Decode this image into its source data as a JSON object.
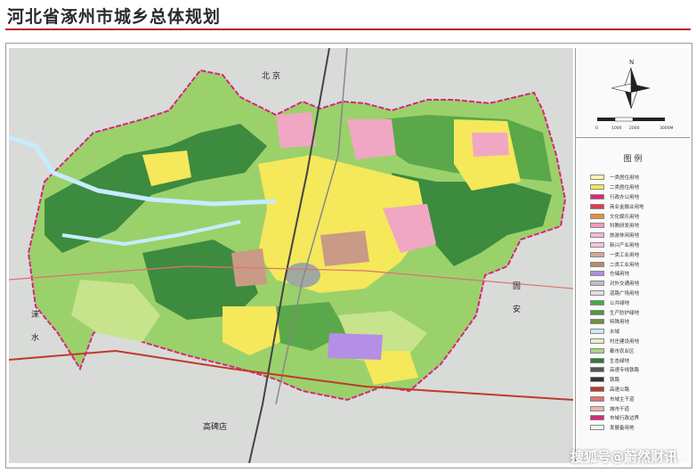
{
  "title": "河北省涿州市城乡总体规划",
  "map": {
    "labels": {
      "beijing": "北 京",
      "laishui": "涞",
      "laishui2": "水",
      "guoan": "固",
      "guoan2": "安",
      "gaobeidian": "高碑店",
      "compass_n": "N"
    },
    "colors": {
      "background": "#d9dbd9",
      "agri_green": "#9bd16b",
      "eco_green": "#3c8b3f",
      "mid_green": "#5aa84a",
      "light_green": "#c7e38c",
      "residential_yellow": "#f5e85a",
      "pink": "#f0a7c4",
      "water": "#c7ecff",
      "purple": "#b58ee6",
      "brown": "#c99a86",
      "boundary": "#d6267b"
    }
  },
  "legend": {
    "title": "图 例",
    "scale_labels": [
      "0",
      "1000",
      "2000",
      "3000M"
    ],
    "items": [
      {
        "label": "一类居住用地",
        "color": "#fff6a8"
      },
      {
        "label": "二类居住用地",
        "color": "#f7e84a"
      },
      {
        "label": "行政办公用地",
        "color": "#e8207a"
      },
      {
        "label": "商业金融业用地",
        "color": "#e33a4b"
      },
      {
        "label": "文化娱乐用地",
        "color": "#f08c3a"
      },
      {
        "label": "科教研发用地",
        "color": "#f29ac2"
      },
      {
        "label": "旅游休闲用地",
        "color": "#f6b7d2"
      },
      {
        "label": "新兴产业用地",
        "color": "#f4c6d5"
      },
      {
        "label": "一类工业用地",
        "color": "#d9a590"
      },
      {
        "label": "二类工业用地",
        "color": "#b98a72"
      },
      {
        "label": "仓储用地",
        "color": "#b08be0"
      },
      {
        "label": "对外交通用地",
        "color": "#bfbfbf"
      },
      {
        "label": "道路广场用地",
        "color": "#e0e0e0"
      },
      {
        "label": "公共绿地",
        "color": "#3fae49"
      },
      {
        "label": "生产防护绿地",
        "color": "#4f9a3a"
      },
      {
        "label": "特殊用地",
        "color": "#6e8f3d"
      },
      {
        "label": "水域",
        "color": "#c8ecff"
      },
      {
        "label": "村庄建设用地",
        "color": "#e6f2c6"
      },
      {
        "label": "都市农业区",
        "color": "#a6d978"
      },
      {
        "label": "生态绿地",
        "color": "#2f7d35"
      },
      {
        "label": "高速专线铁路",
        "color": "#555555"
      },
      {
        "label": "铁路",
        "color": "#333333"
      },
      {
        "label": "高速公路",
        "color": "#c0392b"
      },
      {
        "label": "市域主干道",
        "color": "#e07070"
      },
      {
        "label": "城市干道",
        "color": "#f0b0b0"
      },
      {
        "label": "市域行政边界",
        "color": "#d6267b"
      },
      {
        "label": "发展备用地",
        "color": "#f3f3f3"
      }
    ]
  },
  "watermark": "搜狐号@蔚然财讯"
}
